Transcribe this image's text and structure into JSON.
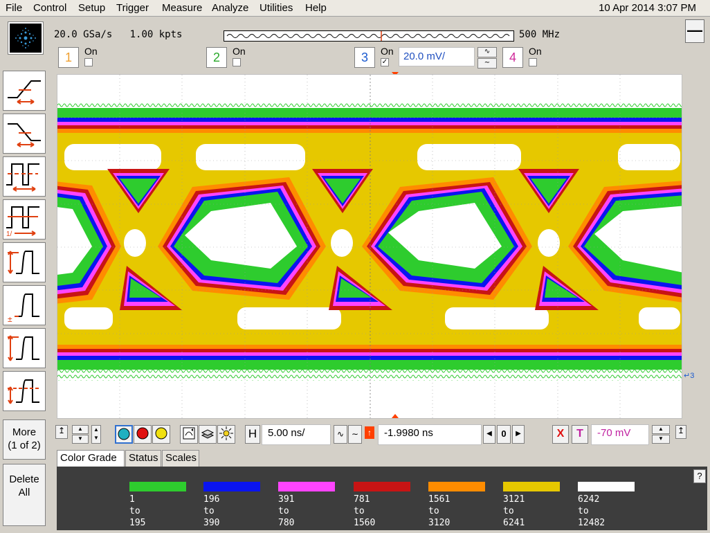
{
  "menu": [
    "File",
    "Control",
    "Setup",
    "Trigger",
    "Measure",
    "Analyze",
    "Utilities",
    "Help"
  ],
  "datetime": "10 Apr 2014  3:07 PM",
  "acquisition": {
    "sample_rate": "20.0 GSa/s",
    "memory_depth": "1.00 kpts",
    "bandwidth": "500 MHz"
  },
  "channels": [
    {
      "number": "1",
      "on_label": "On",
      "enabled": false,
      "color": "#f0a030"
    },
    {
      "number": "2",
      "on_label": "On",
      "enabled": false,
      "color": "#2aa82a"
    },
    {
      "number": "3",
      "on_label": "On",
      "enabled": true,
      "color": "#1a5ad0",
      "scale": "20.0 mV/"
    },
    {
      "number": "4",
      "on_label": "On",
      "enabled": false,
      "color": "#d02a9a"
    }
  ],
  "side_buttons": {
    "more_line1": "More",
    "more_line2": "(1 of 2)",
    "delete_line1": "Delete",
    "delete_line2": "All"
  },
  "horizontal": {
    "label": "H",
    "scale": "5.00 ns/",
    "delay": "-1.9980 ns",
    "reference": "0"
  },
  "trigger": {
    "source_label": "X",
    "type_label": "T",
    "level": "-70 mV",
    "level_color": "#c020a0"
  },
  "tabs": [
    {
      "label": "Color Grade",
      "active": true
    },
    {
      "label": "Status",
      "active": false
    },
    {
      "label": "Scales",
      "active": false
    }
  ],
  "color_grade_legend": [
    {
      "color": "#2ecc2e",
      "from": "1",
      "to_word": "to",
      "to": "195"
    },
    {
      "color": "#0a14f0",
      "from": "196",
      "to_word": "to",
      "to": "390"
    },
    {
      "color": "#ff44ff",
      "from": "391",
      "to_word": "to",
      "to": "780"
    },
    {
      "color": "#c81414",
      "from": "781",
      "to_word": "to",
      "to": "1560"
    },
    {
      "color": "#ff8c00",
      "from": "1561",
      "to_word": "to",
      "to": "3120"
    },
    {
      "color": "#e6c800",
      "from": "3121",
      "to_word": "to",
      "to": "6241"
    },
    {
      "color": "#ffffff",
      "from": "6242",
      "to_word": "to",
      "to": "12482"
    }
  ],
  "ch3_marker": "3",
  "help_label": "?"
}
